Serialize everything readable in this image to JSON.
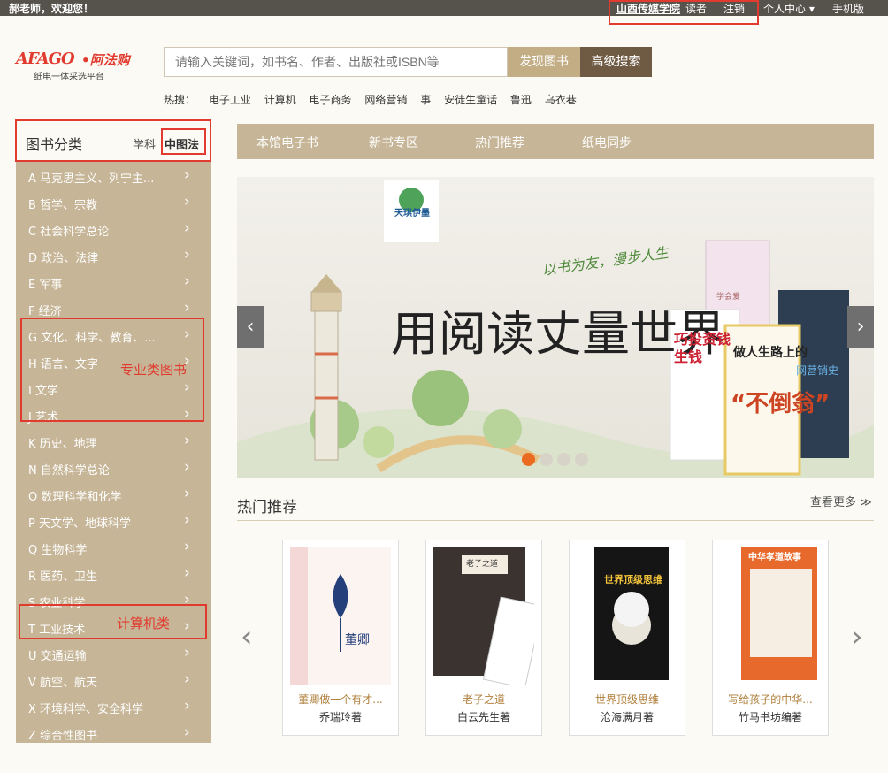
{
  "topbar": {
    "greeting": "郝老师，欢迎您！",
    "institution": "山西传媒学院",
    "role": "读者",
    "logout": "注销",
    "personal_center": "个人中心 ▾",
    "mobile": "手机版"
  },
  "logo": {
    "mark": "AFAGO",
    "name": "•阿法购",
    "tagline": "纸电一体采选平台"
  },
  "search": {
    "placeholder": "请输入关键词，如书名、作者、出版社或ISBN等",
    "find_button": "发现图书",
    "advanced_button": "高级搜索"
  },
  "hot_search": {
    "label": "热搜：",
    "terms": [
      "电子工业",
      "计算机",
      "电子商务",
      "网络营销",
      "事",
      "安徒生童话",
      "鲁迅",
      "乌衣巷"
    ]
  },
  "sidebar": {
    "title": "图书分类",
    "tab_subject": "学科",
    "tab_clc": "中图法",
    "categories": [
      "A 马克思主义、列宁主...",
      "B 哲学、宗教",
      "C 社会科学总论",
      "D 政治、法律",
      "E 军事",
      "F 经济",
      "G 文化、科学、教育、...",
      "H 语言、文字",
      "I 文学",
      "J 艺术",
      "K 历史、地理",
      "N 自然科学总论",
      "O 数理科学和化学",
      "P 天文学、地球科学",
      "Q 生物科学",
      "R 医药、卫生",
      "S 农业科学",
      "T 工业技术",
      "U 交通运输",
      "V 航空、航天",
      "X 环境科学、安全科学",
      "Z 综合性图书"
    ],
    "annotation_professional": "专业类图书",
    "annotation_computer": "计算机类"
  },
  "nav": {
    "items": [
      "本馆电子书",
      "新书专区",
      "热门推荐",
      "纸电同步"
    ]
  },
  "banner": {
    "badge": "天琪伊墨",
    "slogan": "以书为友，漫步人生",
    "headline": "用阅读丈量世界",
    "book1": "巧投资钱生钱",
    "book2_title": "做人生路上的",
    "book2_big": "“不倒翁”",
    "book3": "网营销史",
    "book4": "学会爱",
    "slide_count": 4
  },
  "hot_picks": {
    "title": "热门推荐",
    "more": "查看更多 ≫",
    "books": [
      {
        "title": "董卿做一个有才...",
        "author": "乔瑞玲著",
        "cover_text": "董卿"
      },
      {
        "title": "老子之道",
        "author": "白云先生著",
        "cover_text": "老子之道"
      },
      {
        "title": "世界顶级思维",
        "author": "沧海满月著",
        "cover_text": "世界顶级思维"
      },
      {
        "title": "写给孩子的中华...",
        "author": "竹马书坊编著",
        "cover_text": "中华孝道故事"
      }
    ]
  },
  "colors": {
    "accent_tan": "#c6b597",
    "dark_brown": "#6f5a43",
    "annotation_red": "#e13b30",
    "active_dot": "#ea6a1f",
    "topbar": "#56534d"
  }
}
